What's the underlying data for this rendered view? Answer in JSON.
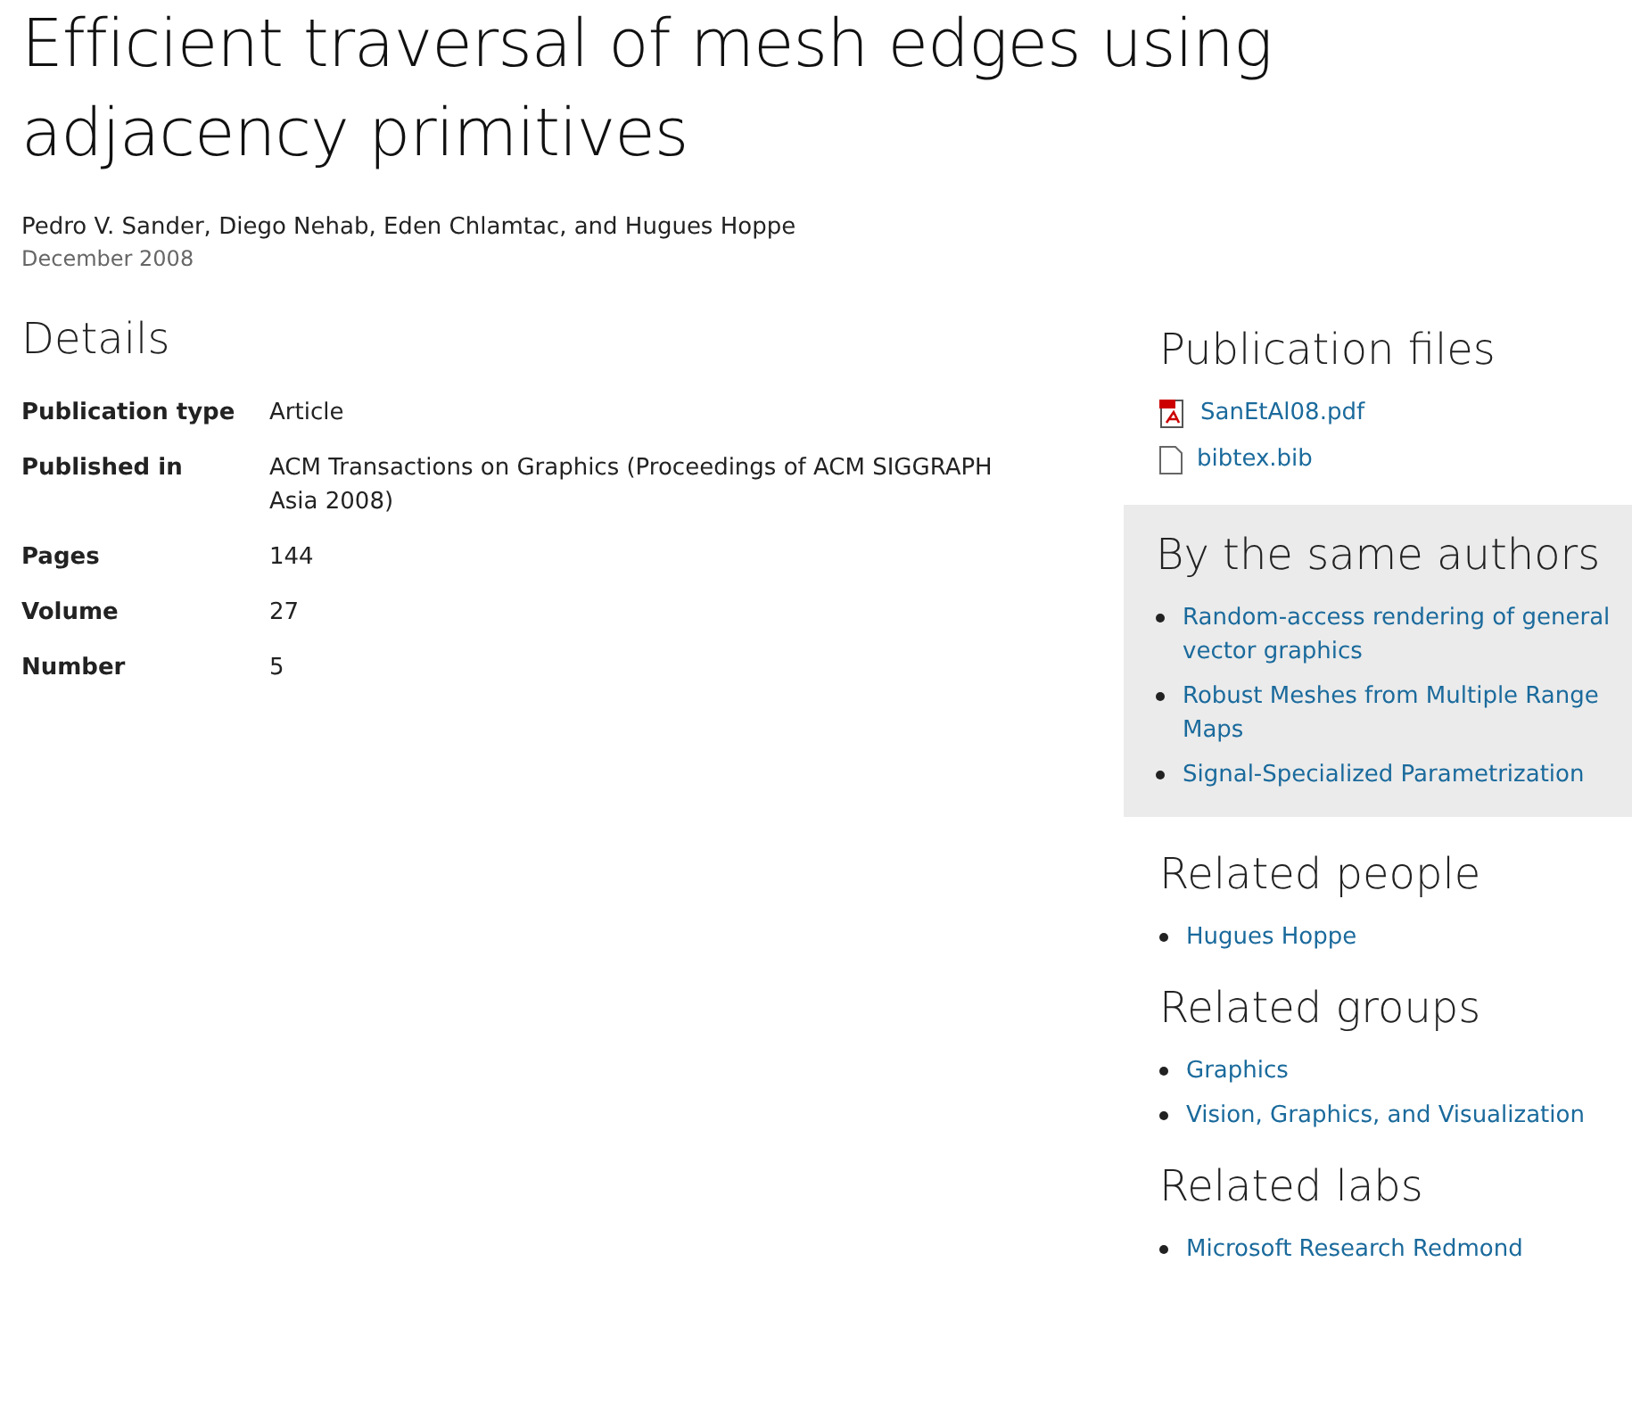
{
  "title": "Efficient traversal of mesh edges using adjacency primitives",
  "authors": "Pedro V. Sander, Diego Nehab, Eden Chlamtac, and Hugues Hoppe",
  "date": "December 2008",
  "details": {
    "heading": "Details",
    "rows": [
      {
        "label": "Publication type",
        "value": "Article"
      },
      {
        "label": "Published in",
        "value": "ACM Transactions on Graphics (Proceedings of ACM SIGGRAPH Asia 2008)"
      },
      {
        "label": "Pages",
        "value": "144"
      },
      {
        "label": "Volume",
        "value": "27"
      },
      {
        "label": "Number",
        "value": "5"
      }
    ]
  },
  "publication_files": {
    "heading": "Publication files",
    "files": [
      {
        "kind": "pdf",
        "name": "SanEtAl08.pdf"
      },
      {
        "kind": "file",
        "name": "bibtex.bib"
      }
    ]
  },
  "same_authors": {
    "heading": "By the same authors",
    "links": [
      "Random-access rendering of general vector graphics",
      "Robust Meshes from Multiple Range Maps",
      "Signal-Specialized Parametrization"
    ]
  },
  "related_people": {
    "heading": "Related people",
    "links": [
      "Hugues Hoppe"
    ]
  },
  "related_groups": {
    "heading": "Related groups",
    "links": [
      "Graphics",
      "Vision, Graphics, and Visualization"
    ]
  },
  "related_labs": {
    "heading": "Related labs",
    "links": [
      "Microsoft Research Redmond"
    ]
  }
}
